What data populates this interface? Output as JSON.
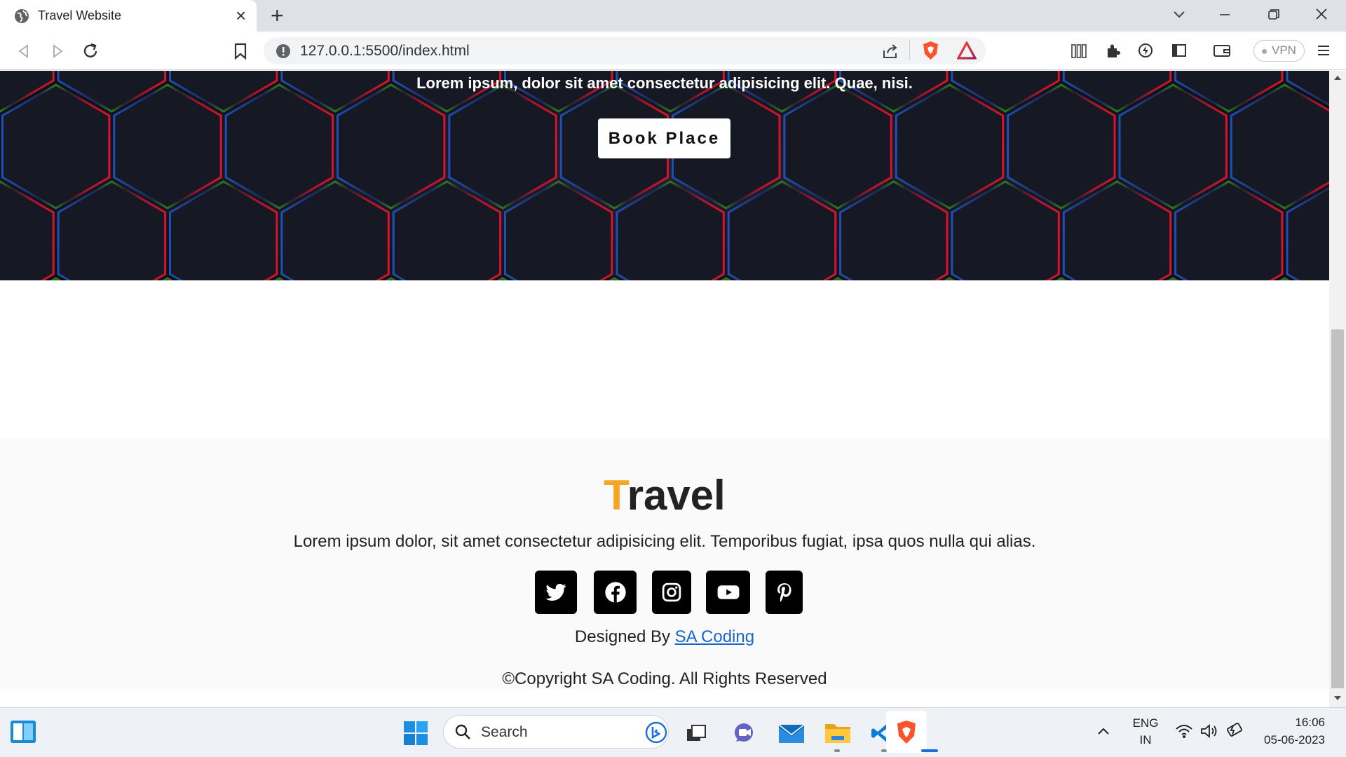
{
  "browser": {
    "tab_title": "Travel Website",
    "url": "127.0.0.1:5500/index.html",
    "vpn_label": "VPN"
  },
  "hero": {
    "text": "Lorem ipsum, dolor sit amet consectetur adipisicing elit. Quae, nisi.",
    "button_label": "Book Place"
  },
  "footer": {
    "brand_first": "T",
    "brand_rest": "ravel",
    "brand_accent_color": "#f5a623",
    "description": "Lorem ipsum dolor, sit amet consectetur adipisicing elit. Temporibus fugiat, ipsa quos nulla qui alias.",
    "social_icons": [
      "twitter-icon",
      "facebook-icon",
      "instagram-icon",
      "youtube-icon",
      "pinterest-icon"
    ],
    "designed_prefix": "Designed By ",
    "designed_link": "SA Coding",
    "copyright": "©Copyright SA Coding. All Rights Reserved"
  },
  "taskbar": {
    "search_label": "Search",
    "lang_top": "ENG",
    "lang_bottom": "IN",
    "time": "16:06",
    "date": "05-06-2023"
  }
}
